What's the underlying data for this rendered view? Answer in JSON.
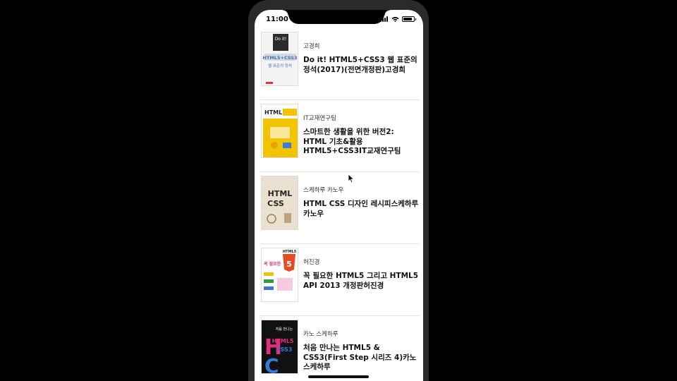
{
  "status_bar": {
    "time": "11:00"
  },
  "books": [
    {
      "author": "고경희",
      "title": "Do it! HTML5+CSS3 웹 표준의 정석(2017)(전면개정판)고경희",
      "cover_colors": [
        "#f4f4f2",
        "#2b2b2b",
        "#4a6fa8"
      ],
      "cover_text": [
        "Do it!",
        "HTML5+CSS3",
        "웹 표준의 정석"
      ]
    },
    {
      "author": "IT교재연구팀",
      "title": "스마트한 생활을 위한 버전2: HTML 기초&활용 HTML5+CSS3IT교재연구팀",
      "cover_colors": [
        "#ffffff",
        "#f2c400",
        "#222222"
      ],
      "cover_text": [
        "HTML"
      ]
    },
    {
      "author": "스케하루 카노우",
      "title": "HTML CSS 디자인 레시피스케하루 카노우",
      "cover_colors": [
        "#e9e0cf",
        "#2a2420",
        "#9b7b52"
      ],
      "cover_text": [
        "HTML",
        "CSS"
      ]
    },
    {
      "author": "허진경",
      "title": "꼭 필요한 HTML5 그리고 HTML5 API 2013 개정판허진경",
      "cover_colors": [
        "#ffffff",
        "#e44d26",
        "#2f9e4a"
      ],
      "cover_text": [
        "꼭 필요한",
        "HTML5",
        "5"
      ]
    },
    {
      "author": "카노 스케하루",
      "title": "처음 만나는 HTML5 & CSS3(First Step 시리즈 4)카노 스케하루",
      "cover_colors": [
        "#111111",
        "#e0307a",
        "#3a78d8"
      ],
      "cover_text": [
        "HTML5",
        "CSS3",
        "처음 만나는"
      ]
    }
  ]
}
